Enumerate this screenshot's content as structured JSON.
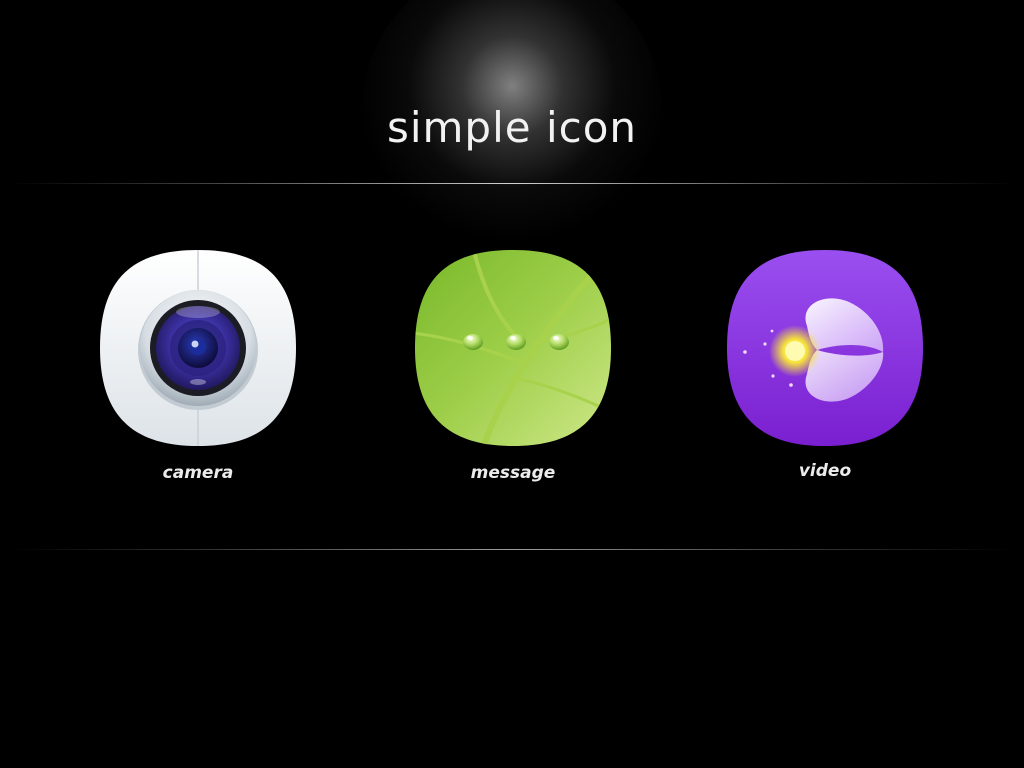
{
  "header": {
    "title": "simple icon"
  },
  "apps": [
    {
      "label": "camera",
      "icon": "camera-lens-icon",
      "color": "#f4f6f8"
    },
    {
      "label": "message",
      "icon": "leaf-message-icon",
      "color": "#8cc63f"
    },
    {
      "label": "video",
      "icon": "video-play-icon",
      "color": "#8a3ee0"
    }
  ]
}
